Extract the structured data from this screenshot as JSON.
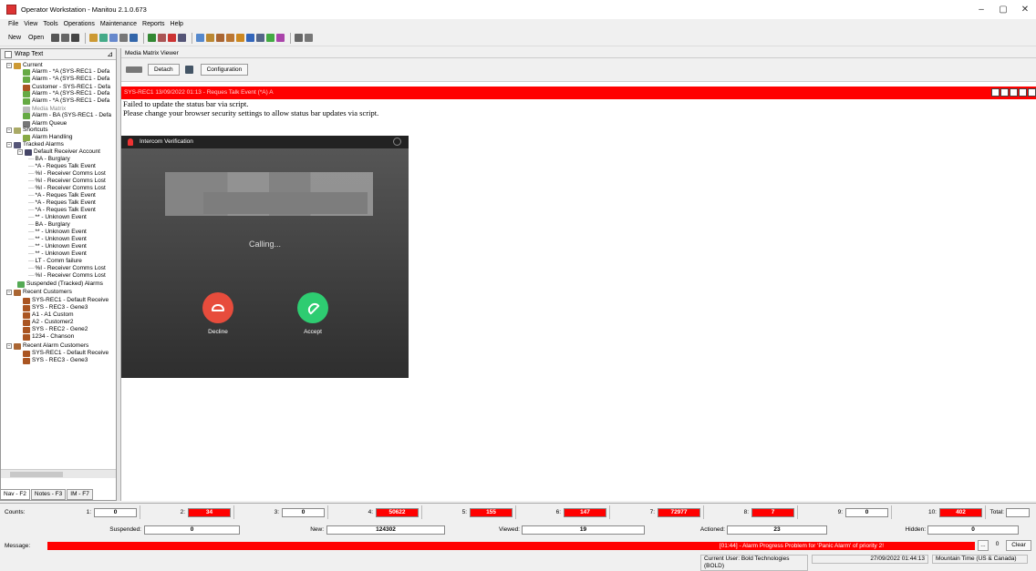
{
  "window": {
    "title": "Operator Workstation - Manitou 2.1.0.673",
    "controls": [
      "–",
      "▢",
      "✕"
    ]
  },
  "menu": [
    "File",
    "View",
    "Tools",
    "Operations",
    "Maintenance",
    "Reports",
    "Help"
  ],
  "toolbar": {
    "new_label": "New",
    "open_label": "Open"
  },
  "left": {
    "wrap_text": "Wrap Text",
    "tree": [
      "Current",
      "Alarm - *A (SYS-REC1 - Defa",
      "Alarm - *A (SYS-REC1 - Defa",
      "Customer - SYS-REC1 - Defa",
      "Alarm - *A (SYS-REC1 - Defa",
      "Alarm - *A (SYS-REC1 - Defa",
      "Media Matrix",
      "Alarm - BA (SYS-REC1 - Defa",
      "Alarm Queue",
      "Shortcuts",
      "Alarm Handling",
      "Tracked Alarms",
      "Default Receiver Account",
      "BA - Burglary",
      "*A - Reques Talk Event",
      "%I - Receiver Comms Lost",
      "%I - Receiver Comms Lost",
      "%I - Receiver Comms Lost",
      "*A - Reques Talk Event",
      "*A - Reques Talk Event",
      "*A - Reques Talk Event",
      "** - Unknown Event",
      "BA - Burglary",
      "** - Unknown Event",
      "** - Unknown Event",
      "** - Unknown Event",
      "** - Unknown Event",
      "LT - Comm failure",
      "%I - Receiver Comms Lost",
      "%I - Receiver Comms Lost",
      "Suspended (Tracked) Alarms",
      "Recent Customers",
      "SYS-REC1 - Default Receive",
      "SYS - REC3 - Gene3",
      "A1 - A1 Custom",
      "A2 - Customer2",
      "SYS - REC2 - Gene2",
      "1234 - Chanson",
      "Recent Alarm Customers",
      "SYS-REC1 - Default Receive",
      "SYS - REC3 - Gene3"
    ],
    "tabs": [
      "Nav - F2",
      "Notes - F3",
      "IM - F7"
    ]
  },
  "main": {
    "viewer_title": "Media Matrix Viewer",
    "detach_label": "Detach",
    "configuration_label": "Configuration",
    "event_bar": "SYS-REC1 13/09/2022 01:13 - Reques Talk Event (*A) A",
    "msg1": "Failed to update the status bar via script.",
    "msg2": "Please change your browser security settings to allow status bar updates via script.",
    "intercom_title": "Intercom Verification",
    "calling": "Calling...",
    "decline": "Decline",
    "accept": "Accept"
  },
  "counts": {
    "label": "Counts:",
    "items": [
      {
        "n": "1:",
        "v": "0"
      },
      {
        "n": "2:",
        "v": "34"
      },
      {
        "n": "3:",
        "v": "0"
      },
      {
        "n": "4:",
        "v": "50622"
      },
      {
        "n": "5:",
        "v": "155"
      },
      {
        "n": "6:",
        "v": "147"
      },
      {
        "n": "7:",
        "v": "72977"
      },
      {
        "n": "8:",
        "v": "7"
      },
      {
        "n": "9:",
        "v": "0"
      },
      {
        "n": "10:",
        "v": "402"
      }
    ],
    "total_label": "Total:",
    "total_value": "",
    "suspended_label": "Suspended:",
    "suspended": "0",
    "new_label": "New:",
    "new": "124302",
    "viewed_label": "Viewed:",
    "viewed": "19",
    "actioned_label": "Actioned:",
    "actioned": "23",
    "hidden_label": "Hidden:",
    "hidden": "0"
  },
  "message": {
    "label": "Message:",
    "text": "[01:44] - Alarm Progress Problem for 'Panic Alarm' of priority 2!",
    "more": "...",
    "count": "0",
    "clear": "Clear"
  },
  "status": {
    "user": "Current User: Bold Technologies (BOLD)",
    "datetime": "27/09/2022 01:44:13",
    "tz": "Mountain Time (US & Canada)"
  }
}
